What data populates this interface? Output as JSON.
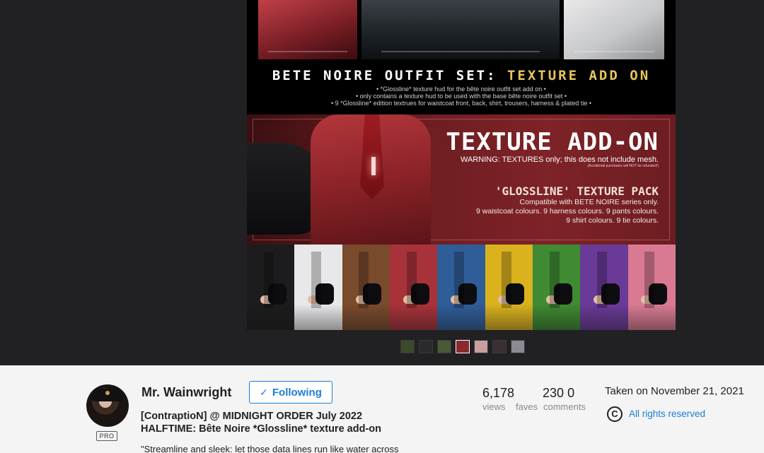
{
  "photo": {
    "set_title_main": "BETE NOIRE OUTFIT SET:",
    "set_title_accent": "TEXTURE ADD ON",
    "notes": [
      "• *Glossline* texture hud for the bête noire outfit set add on •",
      "• only contains a texture hud to be used with the base bête noire outfit set •",
      "• 9 *Glossline* edition textrues for waistcoat front, back, shirt, trousers, harness & plated tie •"
    ],
    "banner_title": "TEXTURE ADD-ON",
    "warning": "WARNING: TEXTURES only; this does not include mesh.",
    "warning_small": "(Accidental purchases will NOT be refunded!)",
    "pack_title": "'GLOSSLINE' TEXTURE PACK",
    "pack_lines": [
      "Compatible with BETE NOIRE series only.",
      "9 waistcoat colours. 9 harness colours. 9 pants colours.",
      "9 shirt colours. 9 tie colours."
    ],
    "swatch_colors": [
      "#1c1c1e",
      "#e8e8ea",
      "#7a4a2c",
      "#a8323a",
      "#2f5d98",
      "#d9b21e",
      "#3f8a32",
      "#6a3a98",
      "#d97a92"
    ],
    "thumb_colors": [
      "#3b4a2c",
      "#2a2a2e",
      "#4b5a36",
      "#8a2a2e",
      "#c9a0a0",
      "#3a3034",
      "#8a8a92"
    ],
    "active_thumb": 3
  },
  "owner": {
    "name": "Mr. Wainwright",
    "badge": "PRO",
    "follow_label": "Following",
    "follow_icon": "check-icon"
  },
  "title_line1": "[ContraptioN] @ MIDNIGHT ORDER July 2022",
  "title_line2": "HALFTIME: Bête Noire *Glossline* texture add-on",
  "description": "\"Streamline and sleek: let those data lines run like water across",
  "stats": {
    "views": "6,178",
    "faves": "230",
    "comments": "0",
    "views_label": "views",
    "faves_label": "faves",
    "comments_label": "comments"
  },
  "taken": "Taken on November 21, 2021",
  "license_icon": "copyright-icon",
  "license": "All rights reserved",
  "colors": {
    "link": "#1c7cd6",
    "viewer_bg": "#212124",
    "panel_bg": "#f4f4f5",
    "accent_gold": "#e7c65a"
  }
}
